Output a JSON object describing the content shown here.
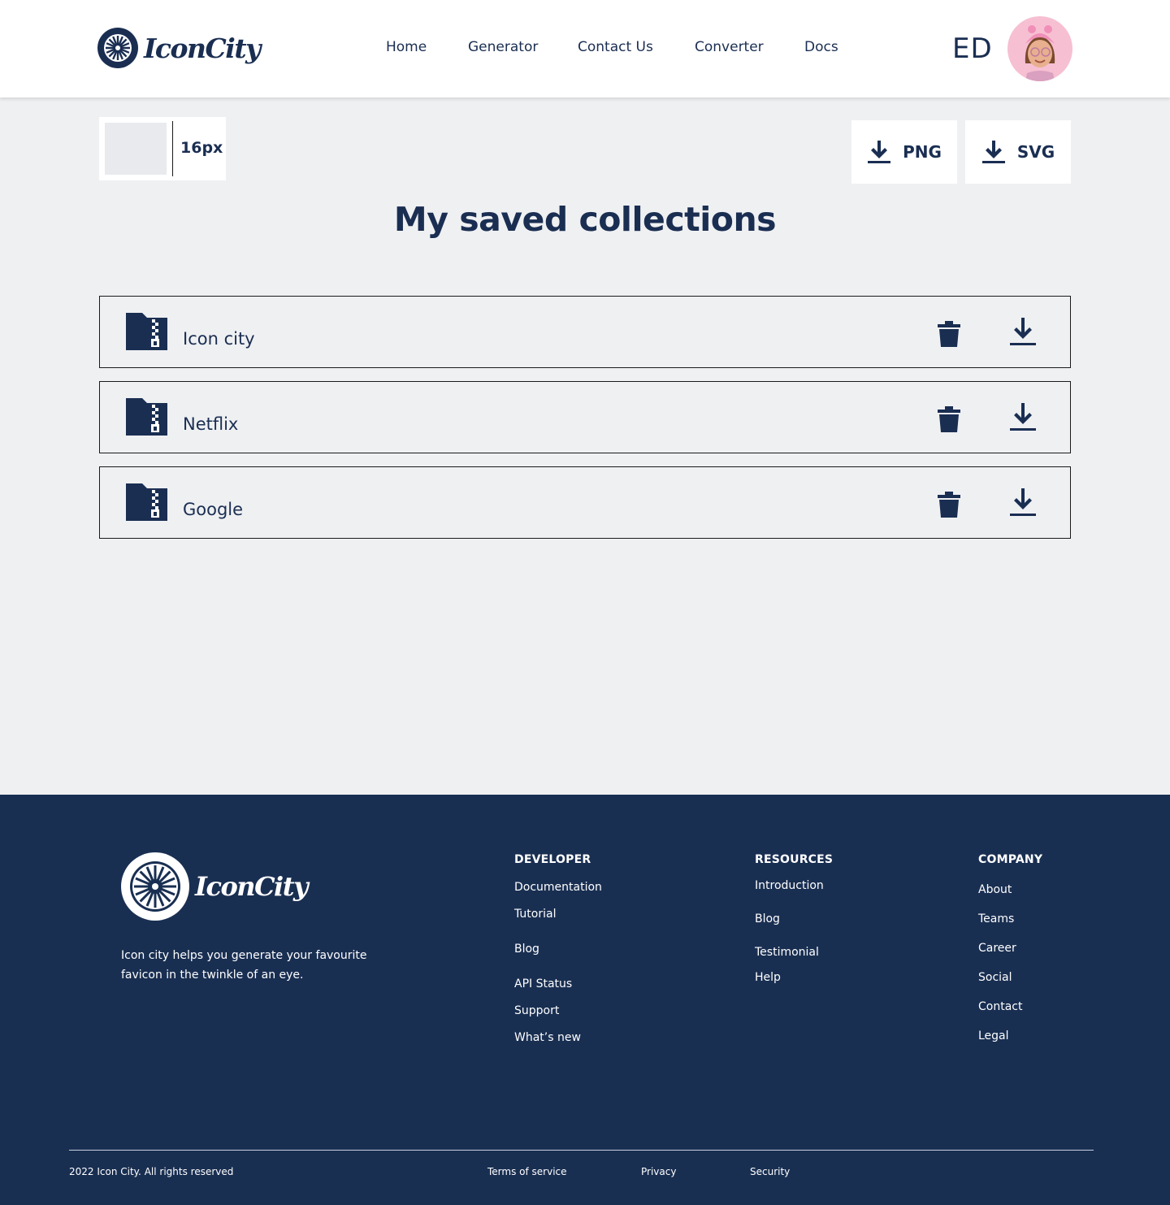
{
  "header": {
    "logo_text": "IconCity",
    "nav": [
      "Home",
      "Generator",
      "Contact Us",
      "Converter",
      "Docs"
    ],
    "user_initials": "ED"
  },
  "toolbar": {
    "size_label": "16px",
    "png_label": "PNG",
    "svg_label": "SVG"
  },
  "page_title": "My saved collections",
  "collections": [
    {
      "name": "Icon city"
    },
    {
      "name": "Netflix"
    },
    {
      "name": "Google"
    }
  ],
  "footer": {
    "logo_text": "IconCity",
    "description": "Icon city helps you generate your favourite favicon in the twinkle of an eye.",
    "developer": {
      "heading": "DEVELOPER",
      "links": [
        "Documentation",
        "Tutorial",
        "Blog",
        "API Status",
        "Support",
        "What’s new"
      ]
    },
    "resources": {
      "heading": "RESOURCES",
      "links": [
        "Introduction",
        "Blog",
        "Testimonial",
        "Help"
      ]
    },
    "company": {
      "heading": "COMPANY",
      "links": [
        "About",
        "Teams",
        "Career",
        "Social",
        "Contact",
        "Legal"
      ]
    },
    "copyright": "2022 Icon City.  All rights reserved",
    "bottom_links": [
      "Terms of service",
      "Privacy",
      "Security"
    ]
  },
  "colors": {
    "navy": "#1a2e52",
    "footer_bg": "#192f52",
    "page_bg": "#eff0f2",
    "avatar_bg": "#f7bfd2"
  }
}
